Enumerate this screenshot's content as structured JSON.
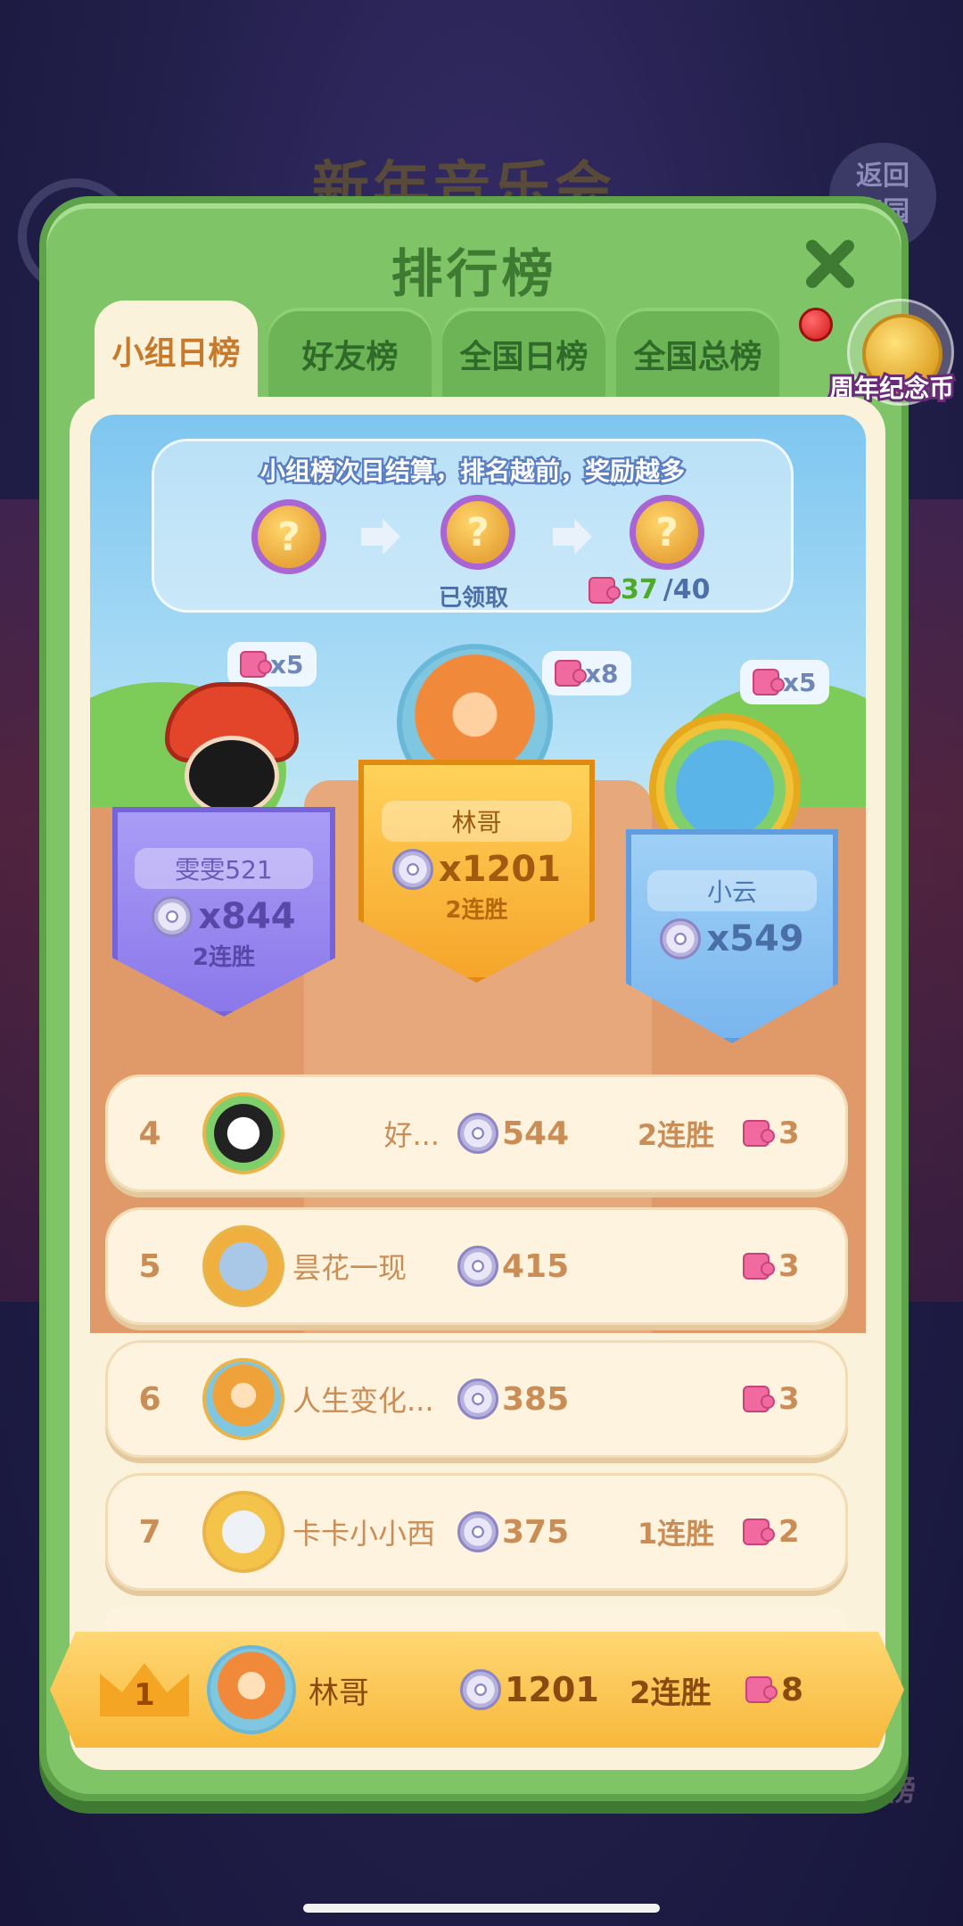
{
  "background": {
    "event_title": "新年音乐会",
    "back_button": "返回\n家园",
    "bottom_label": "记忆榜"
  },
  "modal": {
    "title": "排行榜",
    "tabs": [
      "小组日榜",
      "好友榜",
      "全国日榜",
      "全国总榜"
    ],
    "active_tab": 0,
    "coin_label": "周年纪念币"
  },
  "reward": {
    "text": "小组榜次日结算，排名越前，奖励越多",
    "chest_symbol": "?",
    "claimed_label": "已领取",
    "progress_current": "37",
    "progress_total": "/40"
  },
  "podium": {
    "first": {
      "name": "林哥",
      "score": "x1201",
      "streak": "2连胜",
      "pieces": "x8"
    },
    "second": {
      "name": "雯雯521",
      "score": "x844",
      "streak": "2连胜",
      "pieces": "x5"
    },
    "third": {
      "name": "小云",
      "score": "x549",
      "streak": "",
      "pieces": "x5"
    }
  },
  "rows": [
    {
      "rank": "4",
      "name": "好...",
      "score": "544",
      "streak": "2连胜",
      "pieces": "3"
    },
    {
      "rank": "5",
      "name": "昙花一现",
      "score": "415",
      "streak": "",
      "pieces": "3"
    },
    {
      "rank": "6",
      "name": "人生变化...",
      "score": "385",
      "streak": "",
      "pieces": "3"
    },
    {
      "rank": "7",
      "name": "卡卡小小西",
      "score": "375",
      "streak": "1连胜",
      "pieces": "2"
    }
  ],
  "my_rank": {
    "rank": "1",
    "name": "林哥",
    "score": "1201",
    "streak": "2连胜",
    "pieces": "8"
  },
  "colors": {
    "modal_green": "#7fc466",
    "panel_cream": "#fbf2dc",
    "gold": "#f7b83a",
    "text_tan": "#c98d55"
  }
}
